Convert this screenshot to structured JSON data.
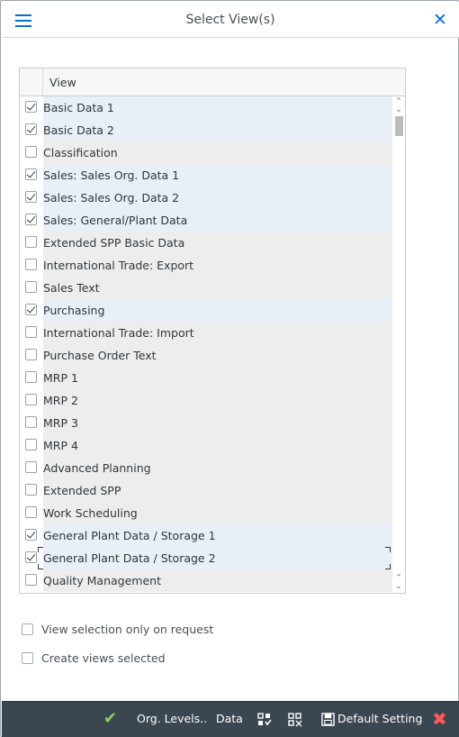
{
  "dialog": {
    "title": "Select View(s)"
  },
  "table": {
    "column_header": "View",
    "rows": [
      {
        "label": "Basic Data 1",
        "checked": true
      },
      {
        "label": "Basic Data 2",
        "checked": true
      },
      {
        "label": "Classification",
        "checked": false
      },
      {
        "label": "Sales: Sales Org. Data 1",
        "checked": true
      },
      {
        "label": "Sales: Sales Org. Data 2",
        "checked": true
      },
      {
        "label": "Sales: General/Plant Data",
        "checked": true
      },
      {
        "label": "Extended SPP Basic Data",
        "checked": false
      },
      {
        "label": "International Trade: Export",
        "checked": false
      },
      {
        "label": "Sales Text",
        "checked": false
      },
      {
        "label": "Purchasing",
        "checked": true
      },
      {
        "label": "International Trade: Import",
        "checked": false
      },
      {
        "label": "Purchase Order Text",
        "checked": false
      },
      {
        "label": "MRP 1",
        "checked": false
      },
      {
        "label": "MRP 2",
        "checked": false
      },
      {
        "label": "MRP 3",
        "checked": false
      },
      {
        "label": "MRP 4",
        "checked": false
      },
      {
        "label": "Advanced Planning",
        "checked": false
      },
      {
        "label": "Extended SPP",
        "checked": false
      },
      {
        "label": "Work Scheduling",
        "checked": false
      },
      {
        "label": "General Plant Data / Storage 1",
        "checked": true
      },
      {
        "label": "General Plant Data / Storage 2",
        "checked": true,
        "focused": true
      },
      {
        "label": "Quality Management",
        "checked": false
      }
    ]
  },
  "options": {
    "view_selection_on_request": {
      "label": "View selection only on request",
      "checked": false
    },
    "create_views_selected": {
      "label": "Create views selected",
      "checked": false
    }
  },
  "footer": {
    "org_levels_label": "Org. Levels..",
    "data_label": "Data",
    "default_setting_label": "Default Setting"
  },
  "colors": {
    "accent": "#0a6ed1",
    "footer_bg": "#3a4650",
    "checked_row_bg": "#e8eff6",
    "unchecked_row_bg": "#ededed",
    "ok_green": "#8ed15c",
    "cancel_red": "#ff5a5a"
  },
  "icons": {
    "menu": "hamburger-icon",
    "close": "close-icon",
    "ok": "checkmark-icon",
    "select_all": "select-all-icon",
    "deselect_all": "deselect-all-icon",
    "default_setting": "save-icon",
    "cancel": "cancel-icon"
  }
}
